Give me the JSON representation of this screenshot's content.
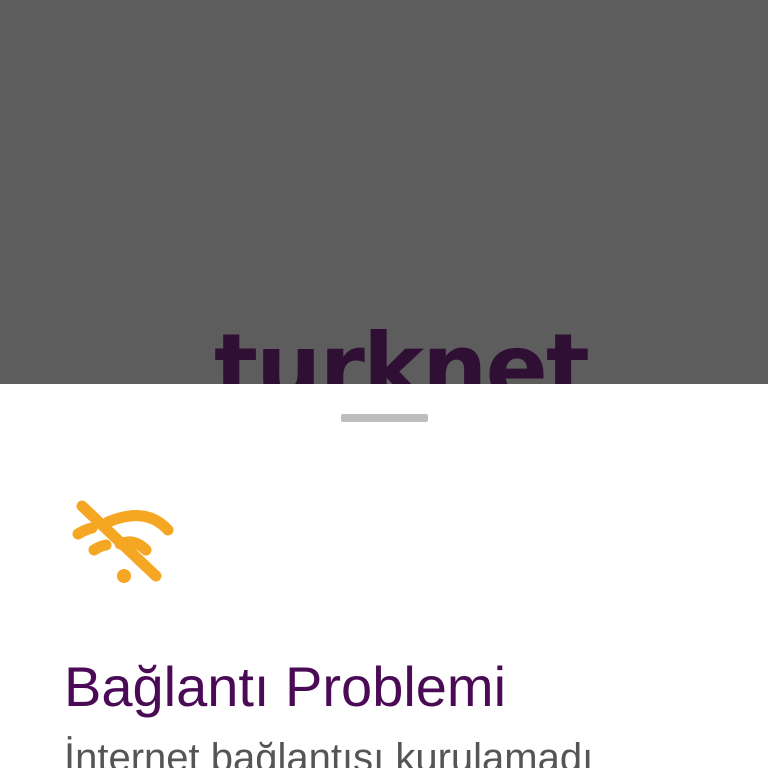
{
  "brand": {
    "logo_text": "turknet",
    "logo_color": "#2f0f33"
  },
  "sheet": {
    "icon": "wifi-off-icon",
    "icon_color": "#f5a623",
    "title": "Bağlantı Problemi",
    "title_color": "#4a0a55",
    "message": "İnternet bağlantısı kurulamadı"
  },
  "colors": {
    "backdrop": "#5d5d5d",
    "sheet_background": "#ffffff",
    "handle": "#bdbdbd"
  }
}
